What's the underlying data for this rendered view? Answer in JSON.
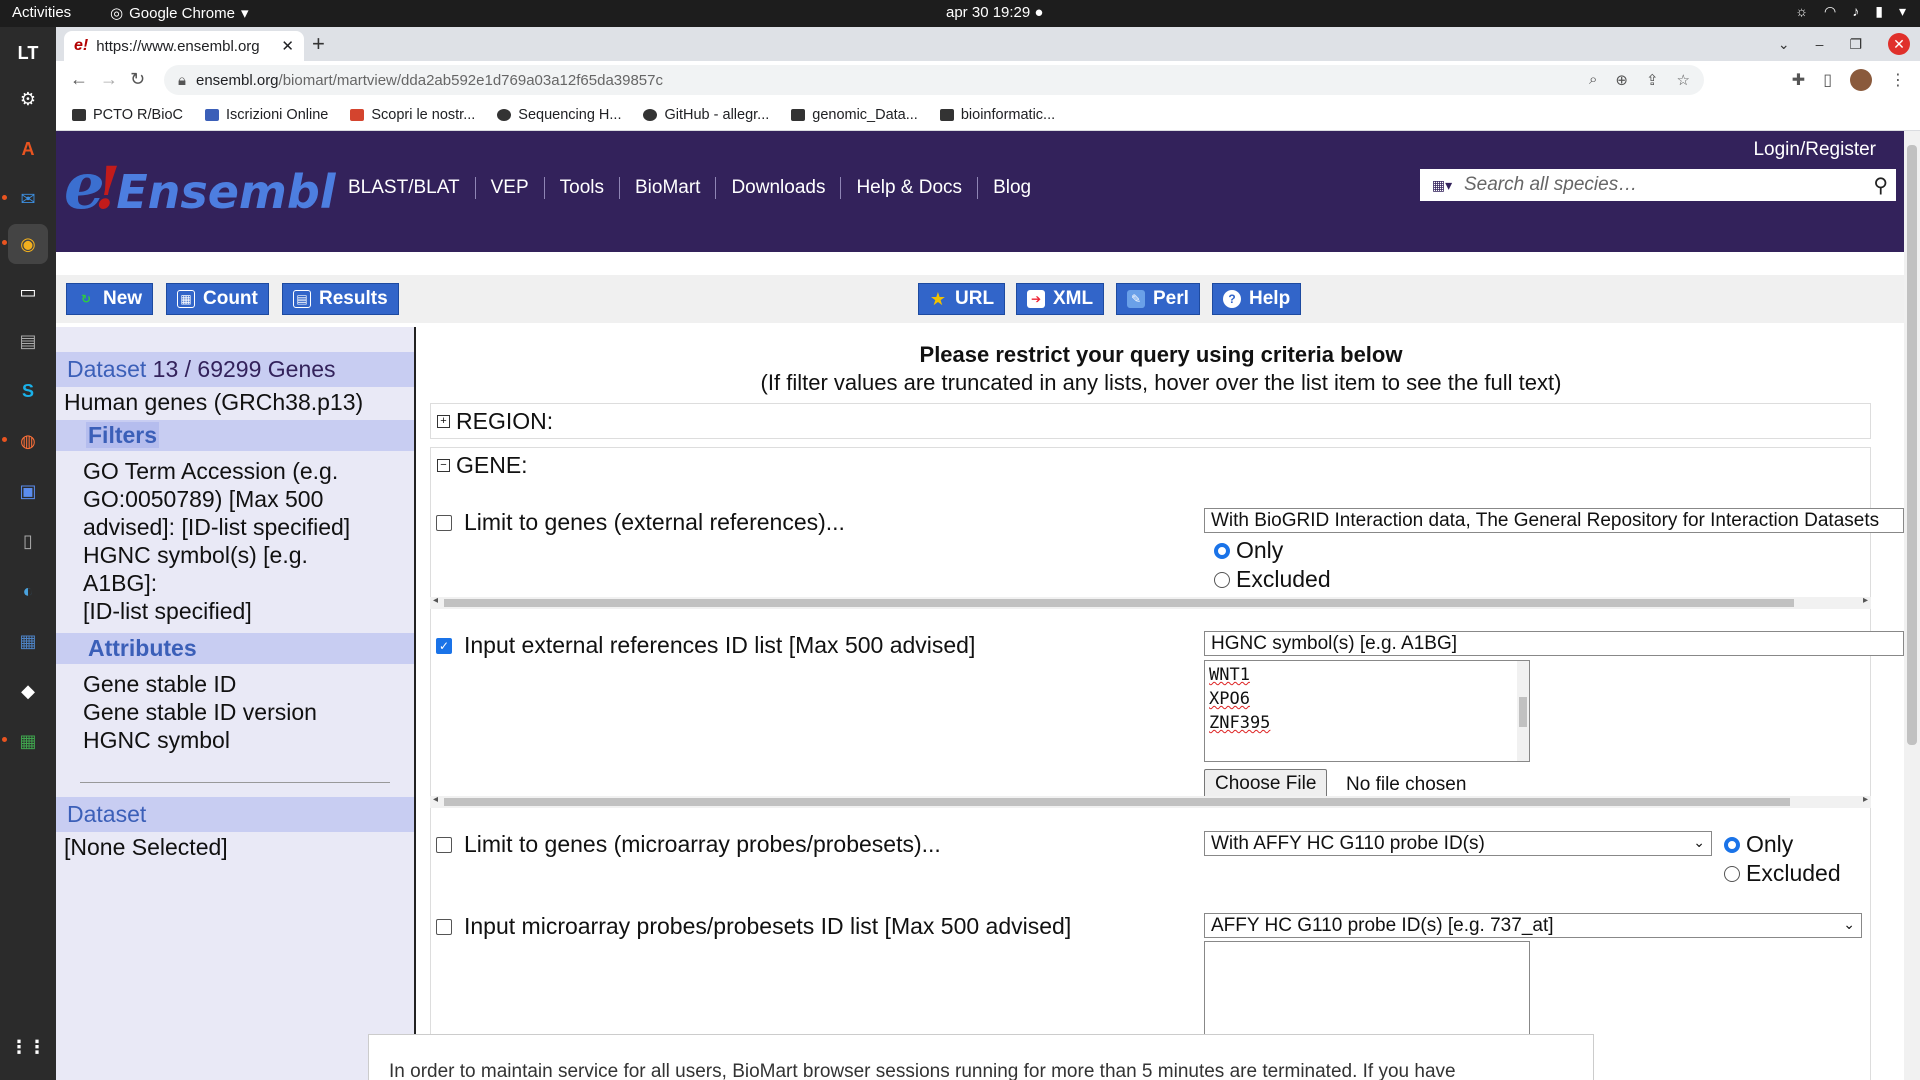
{
  "topbar": {
    "activities": "Activities",
    "app_name": "Google Chrome",
    "clock": "apr 30  19:29"
  },
  "chrome": {
    "tab_title": "https://www.ensembl.org",
    "url_domain": "ensembl.org",
    "url_path": "/biomart/martview/dda2ab592e1d769a03a12f65da39857c",
    "bookmarks": [
      "PCTO R/BioC",
      "Iscrizioni Online",
      "Scopri le nostr...",
      "Sequencing H...",
      "GitHub - allegr...",
      "genomic_Data...",
      "bioinformatic..."
    ]
  },
  "ensembl": {
    "logo_e": "e",
    "logo_bang": "!",
    "logo_word": "Ensembl",
    "nav": [
      "BLAST/BLAT",
      "VEP",
      "Tools",
      "BioMart",
      "Downloads",
      "Help & Docs",
      "Blog"
    ],
    "login": "Login/Register",
    "search_placeholder": "Search all species…"
  },
  "biomart": {
    "toolbar_left": [
      "New",
      "Count",
      "Results"
    ],
    "toolbar_right": [
      "URL",
      "XML",
      "Perl",
      "Help"
    ],
    "sidebar": {
      "dataset_label": "Dataset",
      "dataset_count": "13 / 69299 Genes",
      "dataset_name": "Human genes (GRCh38.p13)",
      "filters_label": "Filters",
      "filters": [
        "GO Term Accession (e.g.",
        "GO:0050789) [Max 500",
        "advised]: [ID-list specified]",
        "HGNC symbol(s) [e.g. A1BG]:",
        "[ID-list specified]"
      ],
      "attributes_label": "Attributes",
      "attributes": [
        "Gene stable ID",
        "Gene stable ID version",
        "HGNC symbol"
      ],
      "dataset2_label": "Dataset",
      "dataset2_value": "[None Selected]"
    },
    "main": {
      "title": "Please restrict your query using criteria below",
      "subtitle": "(If filter values are truncated in any lists, hover over the list item to see the full text)",
      "region_label": "REGION:",
      "gene_label": "GENE:",
      "filters": [
        {
          "label": "Limit to genes (external references)...",
          "checked": false,
          "select": "With BioGRID Interaction data, The General Repository for Interaction Datasets",
          "only": "Only",
          "excluded": "Excluded"
        },
        {
          "label": "Input external references ID list [Max 500 advised]",
          "checked": true,
          "select": "HGNC symbol(s) [e.g. A1BG]",
          "ids": [
            "WNT1",
            "XPO6",
            "ZNF395"
          ],
          "choose_file": "Choose File",
          "no_file": "No file chosen"
        },
        {
          "label": "Limit to genes (microarray probes/probesets)...",
          "checked": false,
          "select": "With AFFY HC G110 probe ID(s)",
          "only": "Only",
          "excluded": "Excluded"
        },
        {
          "label": "Input microarray probes/probesets ID list [Max 500 advised]",
          "checked": false,
          "select": "AFFY HC G110 probe ID(s) [e.g. 737_at]"
        }
      ]
    },
    "notice": "In order to maintain service for all users, BioMart browser sessions running for more than 5 minutes are terminated. If you have"
  }
}
